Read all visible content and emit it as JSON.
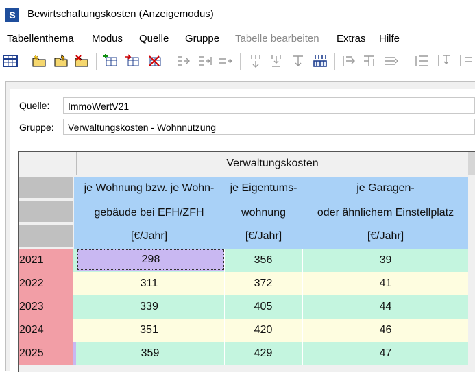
{
  "window": {
    "title": "Bewirtschaftungskosten  (Anzeigemodus)",
    "app_icon_letter": "S"
  },
  "menu": {
    "items": [
      "Tabellenthema",
      "Modus",
      "Quelle",
      "Gruppe",
      "Tabelle bearbeiten",
      "Extras",
      "Hilfe"
    ],
    "disabled": [
      "Tabelle bearbeiten"
    ]
  },
  "toolbar": {
    "icons": [
      "table-icon",
      "new-folder-icon",
      "open-folder-icon",
      "delete-folder-icon",
      "add-table-icon",
      "copy-table-icon",
      "delete-table-icon",
      "insert-column-icon",
      "add-column-icon",
      "append-column-icon",
      "insert-row-icon",
      "add-row-icon",
      "append-row-icon",
      "row-stack-icon",
      "merge-left-icon",
      "merge-right-icon",
      "merge-stack-icon",
      "arrange-icon",
      "arrange-down-icon"
    ]
  },
  "form": {
    "quelle_label": "Quelle:",
    "quelle_value": "ImmoWertV21",
    "gruppe_label": "Gruppe:",
    "gruppe_value": "Verwaltungskosten - Wohnnutzung"
  },
  "table": {
    "group_header": "Verwaltungskosten",
    "columns": [
      {
        "line1": "je Wohnung bzw. je Wohn-",
        "line2": "gebäude bei EFH/ZFH",
        "unit": "[€/Jahr]"
      },
      {
        "line1": "je Eigentums-",
        "line2": "wohnung",
        "unit": "[€/Jahr]"
      },
      {
        "line1": "je Garagen-",
        "line2": "oder ähnlichem Einstellplatz",
        "unit": "[€/Jahr]"
      }
    ],
    "rows": [
      {
        "year": "2021",
        "values": [
          "298",
          "356",
          "39"
        ]
      },
      {
        "year": "2022",
        "values": [
          "311",
          "372",
          "41"
        ]
      },
      {
        "year": "2023",
        "values": [
          "339",
          "405",
          "44"
        ]
      },
      {
        "year": "2024",
        "values": [
          "351",
          "420",
          "46"
        ]
      },
      {
        "year": "2025",
        "values": [
          "359",
          "429",
          "47"
        ]
      }
    ],
    "selected_cell": {
      "row": 0,
      "col": 0
    },
    "colors": {
      "header_blue": "#a9d1f7",
      "year_red": "#f29ea6",
      "row_mint": "#c4f5df",
      "row_cream": "#fefde0",
      "selected": "#c9b8f2"
    }
  }
}
